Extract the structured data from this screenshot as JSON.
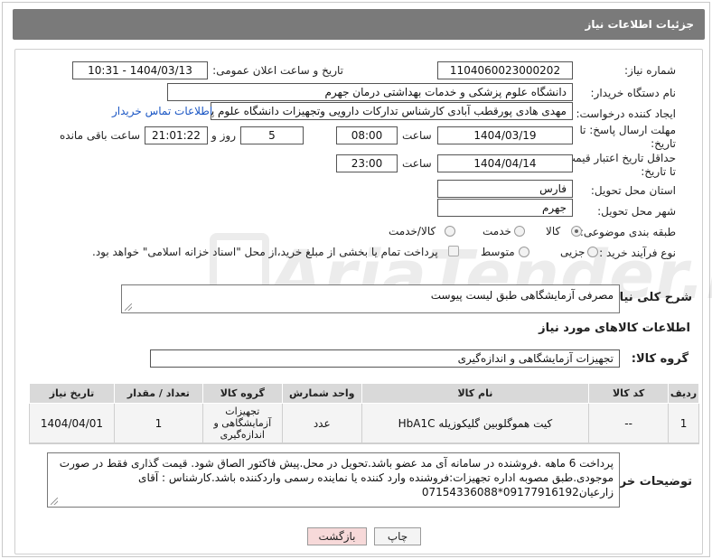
{
  "header": {
    "title": "جزئیات اطلاعات نیاز"
  },
  "fields": {
    "need_number_label": "شماره نیاز:",
    "need_number": "1104060023000202",
    "announce_label": "تاریخ و ساعت اعلان عمومی:",
    "announce_value": "1404/03/13 - 10:31",
    "buyer_org_label": "نام دستگاه خریدار:",
    "buyer_org": "دانشگاه علوم پزشکی و خدمات بهداشتی  درمان جهرم",
    "creator_label": "ایجاد کننده درخواست:",
    "creator": "مهدی هادی پورقطب آبادی کارشناس تدارکات دارویی وتجهیزات دانشگاه علوم پز",
    "contact_link": "اطلاعات تماس خریدار",
    "deadline_label_1": "مهلت ارسال پاسخ: تا",
    "deadline_label_2": "تاریخ:",
    "deadline_date": "1404/03/19",
    "time_label": "ساعت",
    "deadline_time": "08:00",
    "days_value": "5",
    "days_label": "روز و",
    "remaining_time": "21:01:22",
    "remaining_label": "ساعت باقی مانده",
    "validity_label_1": "حداقل تاریخ اعتبار قیمت:",
    "validity_label_2": "تا تاریخ:",
    "validity_date": "1404/04/14",
    "validity_time": "23:00",
    "province_label": "استان محل تحویل:",
    "province": "فارس",
    "city_label": "شهر محل تحویل:",
    "city": "جهرم",
    "category_label": "طبقه بندی موضوعی:",
    "category_options": [
      "کالا",
      "خدمت",
      "کالا/خدمت"
    ],
    "category_selected": "کالا",
    "process_label": "نوع فرآیند خرید :",
    "process_options": [
      "جزیی",
      "متوسط"
    ],
    "payment_note": "پرداخت تمام یا بخشی از مبلغ خرید،از محل \"اسناد خزانه اسلامی\" خواهد بود."
  },
  "description": {
    "label": "شرح کلی نیاز:",
    "value": "مصرفی آزمایشگاهی طبق لیست پیوست"
  },
  "goods_section": {
    "title": "اطلاعات کالاهای مورد نیاز",
    "group_label": "گروه کالا:",
    "group_value": "تجهیزات آزمایشگاهی و اندازه‌گیری"
  },
  "table": {
    "headers": [
      "ردیف",
      "کد کالا",
      "نام کالا",
      "واحد شمارش",
      "گروه کالا",
      "تعداد / مقدار",
      "تاریخ نیاز"
    ],
    "rows": [
      {
        "row": "1",
        "code": "--",
        "name": "کیت هموگلوبین گلیکوزیله HbA1C",
        "unit": "عدد",
        "group": "تجهیزات آزمایشگاهی و اندازه‌گیری",
        "qty": "1",
        "date": "1404/04/01"
      }
    ]
  },
  "buyer_notes": {
    "label": "توضیحات خریدار:",
    "value": "پرداخت 6 ماهه .فروشنده در سامانه آی مد عضو باشد.تحویل در محل.پیش فاکتور الصاق شود. قیمت گذاری فقط در صورت موجودی.طبق مصوبه اداره تجهیزات:فروشنده وارد کننده یا نماینده رسمی واردکننده باشد.کارشناس : آقای زارعیان09177916192*07154336088"
  },
  "buttons": {
    "print": "چاپ",
    "back": "بازگشت"
  },
  "watermark": "AriaTender.neT",
  "colors": {
    "title_bar": "#7a7a7a",
    "link": "#1a56c4",
    "back_button": "#f7d9d9"
  }
}
